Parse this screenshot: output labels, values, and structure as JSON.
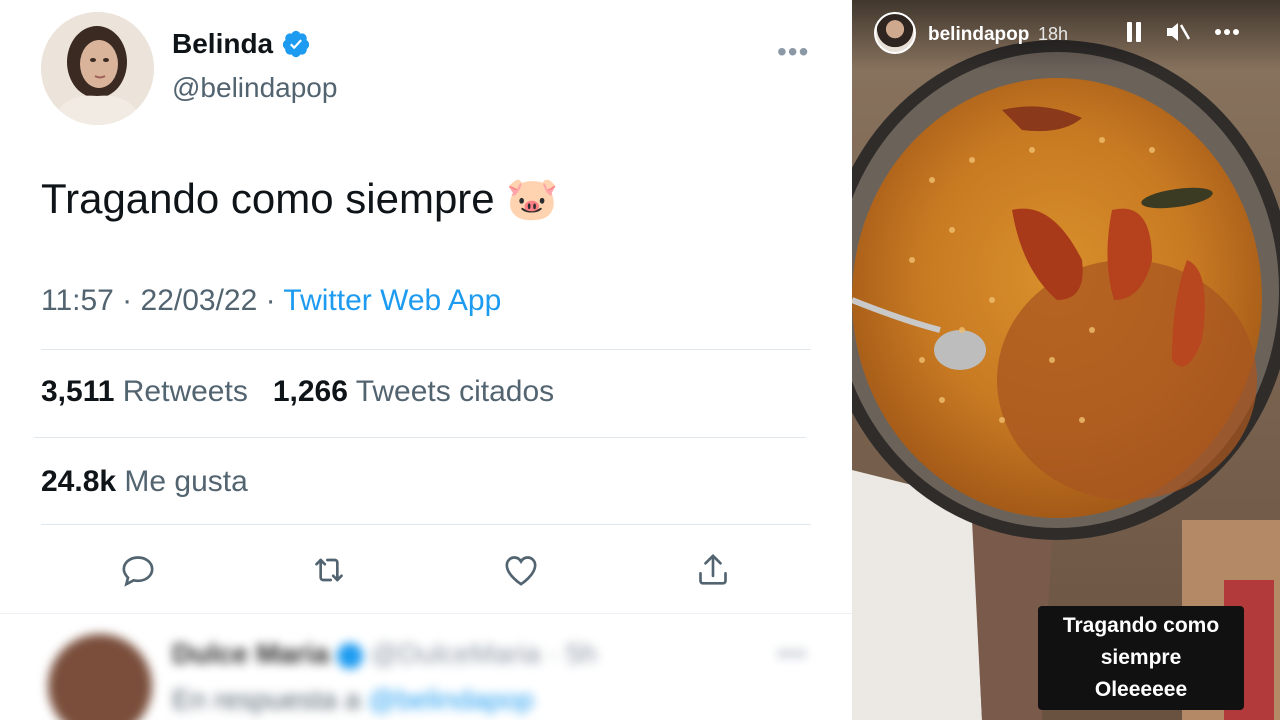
{
  "tweet": {
    "display_name": "Belinda",
    "handle": "@belindapop",
    "more_label": "•••",
    "text": "Tragando como siempre 🐷",
    "time": "11:57 · 22/03/22 · ",
    "source": "Twitter Web App",
    "retweets_count": "3,511",
    "retweets_label": "Retweets",
    "quotes_count": "1,266",
    "quotes_label": "Tweets citados",
    "likes_count": "24.8k",
    "likes_label": "Me gusta",
    "icons": [
      "reply-icon",
      "retweet-icon",
      "like-icon",
      "share-icon"
    ]
  },
  "reply_preview": {
    "name": "Dulce Maria",
    "handle": "@DulceMaria · 5h",
    "line_prefix": "En respuesta a ",
    "line_link": "@belindapop",
    "more_label": "•••"
  },
  "story": {
    "username": "belindapop",
    "time": "18h",
    "controls": [
      "pause-icon",
      "mute-icon",
      "more-icon"
    ],
    "caption_line1": "Tragando como",
    "caption_line2": "siempre",
    "caption_line3": "Oleeeeee"
  },
  "colors": {
    "accent": "#1d9bf0",
    "text_primary": "#0f1419",
    "text_secondary": "#536471",
    "divider": "#e1e8ed"
  }
}
